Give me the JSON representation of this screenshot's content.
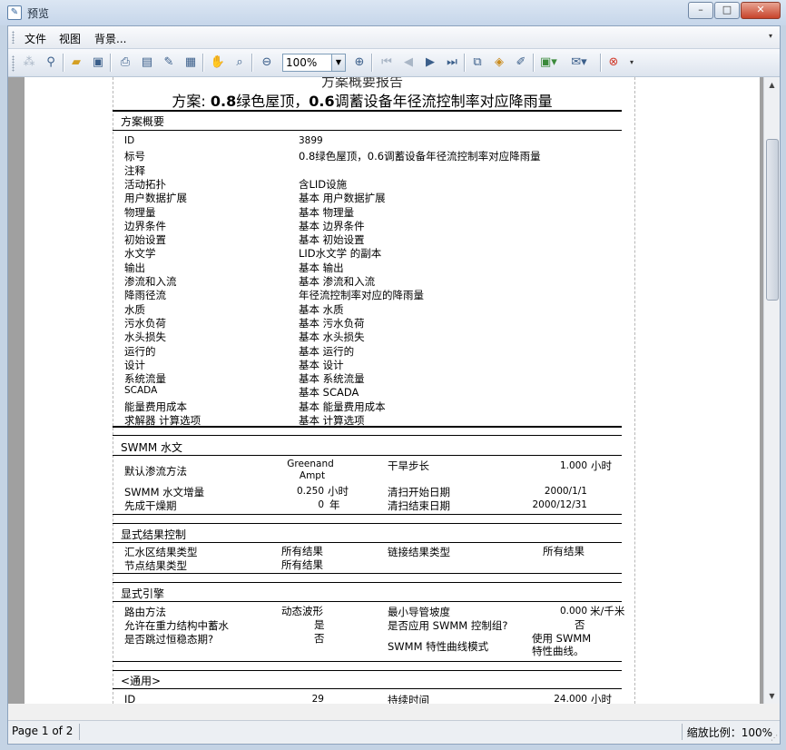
{
  "window": {
    "title": "预览",
    "btn_minimize": "–",
    "btn_maximize": "□",
    "btn_close": "✕"
  },
  "menu": {
    "items": [
      "文件",
      "视图",
      "背景..."
    ]
  },
  "toolbar": {
    "zoom_value": "100%",
    "icons": [
      "print-setup-icon",
      "find-icon",
      "open-icon",
      "save-icon",
      "print-icon",
      "print-preview-icon",
      "page-setup-icon",
      "scale-icon",
      "hand-tool-icon",
      "magnifier-icon",
      "zoom-out-icon",
      "zoom-in-icon",
      "first-page-icon",
      "prev-page-icon",
      "next-page-icon",
      "last-page-icon",
      "multi-page-icon",
      "watermark-icon",
      "edit-icon",
      "export-icon",
      "email-icon",
      "close-preview-icon"
    ]
  },
  "report": {
    "title1": "方案概要报告",
    "title2_prefix": "方案:",
    "title2_num1": "0.8",
    "title2_mid": "绿色屋顶，",
    "title2_num2": "0.6",
    "title2_suffix": "调蓄设备年径流控制率对应降雨量",
    "overview": {
      "section_title": "方案概要",
      "rows": [
        {
          "label": "ID",
          "value": "3899"
        },
        {
          "label": "标号",
          "value": "0.8绿色屋顶，0.6调蓄设备年径流控制率对应降雨量"
        },
        {
          "label": "注释",
          "value": ""
        },
        {
          "label": "活动拓扑",
          "value": "含LID设施"
        },
        {
          "label": "用户数据扩展",
          "value": "基本 用户数据扩展"
        },
        {
          "label": "物理量",
          "value": "基本 物理量"
        },
        {
          "label": "边界条件",
          "value": "基本 边界条件"
        },
        {
          "label": "初始设置",
          "value": "基本 初始设置"
        },
        {
          "label": "水文学",
          "value": "LID水文学 的副本"
        },
        {
          "label": "输出",
          "value": "基本 输出"
        },
        {
          "label": "渗流和入流",
          "value": "基本 渗流和入流"
        },
        {
          "label": "降雨径流",
          "value": "年径流控制率对应的降雨量"
        },
        {
          "label": "水质",
          "value": "基本 水质"
        },
        {
          "label": "污水负荷",
          "value": "基本 污水负荷"
        },
        {
          "label": "水头损失",
          "value": "基本 水头损失"
        },
        {
          "label": "运行的",
          "value": "基本 运行的"
        },
        {
          "label": "设计",
          "value": "基本 设计"
        },
        {
          "label": "系统流量",
          "value": "基本 系统流量"
        },
        {
          "label": "SCADA",
          "value": "基本 SCADA"
        },
        {
          "label": "能量费用成本",
          "value": "基本 能量费用成本"
        },
        {
          "label": "求解器 计算选项",
          "value": "基本 计算选项"
        }
      ]
    },
    "hydrology": {
      "section_title": "SWMM 水文",
      "default_infiltration_label": "默认渗流方法",
      "default_infiltration_value1": "Greenand",
      "default_infiltration_value2": "Ampt",
      "dry_step_label": "干旱步长",
      "dry_step_value": "1.000",
      "dry_step_unit": "小时",
      "wet_step_label": "SWMM 水文增量",
      "wet_step_value": "0.250",
      "wet_step_unit": "小时",
      "sweep_start_label": "清扫开始日期",
      "sweep_start_value": "2000/1/1",
      "antecedent_label": "先成干燥期",
      "antecedent_value": "0",
      "antecedent_unit": "年",
      "sweep_end_label": "清扫结束日期",
      "sweep_end_value": "2000/12/31"
    },
    "results_control": {
      "section_title": "显式结果控制",
      "catchment_label": "汇水区结果类型",
      "catchment_value": "所有结果",
      "link_label": "链接结果类型",
      "link_value": "所有结果",
      "node_label": "节点结果类型",
      "node_value": "所有结果"
    },
    "engine": {
      "section_title": "显式引擎",
      "routing_label": "路由方法",
      "routing_value": "动态波形",
      "min_slope_label": "最小导管坡度",
      "min_slope_value": "0.000",
      "min_slope_unit": "米/千米",
      "ponding_label": "允许在重力结构中蓄水",
      "ponding_value": "是",
      "controls_label": "是否应用 SWMM 控制组?",
      "controls_value": "否",
      "skip_steady_label": "是否跳过恒稳态期?",
      "skip_steady_value": "否",
      "curve_mode_label": "SWMM 特性曲线模式",
      "curve_mode_value1": "使用 SWMM",
      "curve_mode_value2": "特性曲线。"
    },
    "general": {
      "section_title": "<通用>",
      "id_label": "ID",
      "id_value": "29",
      "duration_label": "持续时间",
      "duration_value": "24.000",
      "duration_unit": "小时"
    }
  },
  "status": {
    "page": "Page 1 of 2",
    "zoom": "缩放比例：100%"
  }
}
